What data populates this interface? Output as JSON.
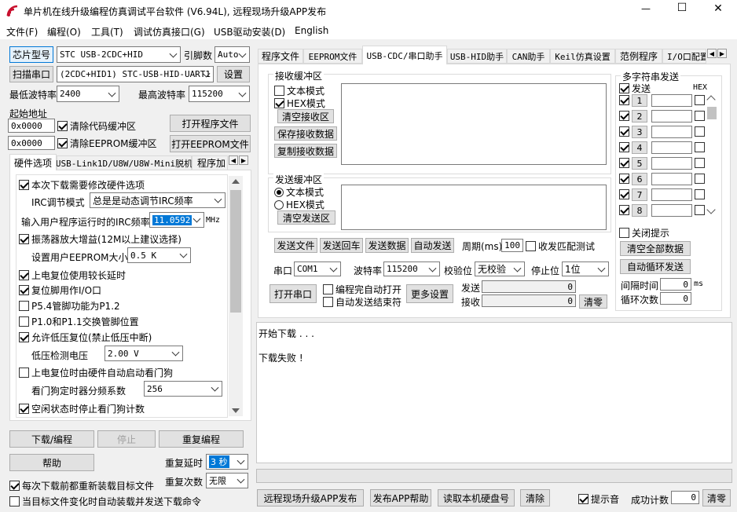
{
  "window": {
    "title": "单片机在线升级编程仿真调试平台软件 (V6.94L), 远程现场升级APP发布",
    "controls": {
      "minimize": "—",
      "maximize": "☐",
      "close": "✕"
    }
  },
  "menu": [
    "文件(F)",
    "编程(O)",
    "工具(T)",
    "调试仿真接口(G)",
    "USB驱动安装(D)",
    "English"
  ],
  "left": {
    "chip_btn": "芯片型号",
    "chip_value": "STC USB-2CDC+HID",
    "pin_label": "引脚数",
    "pin_value": "Auto",
    "scan_btn": "扫描串口",
    "port_value": "(2CDC+HID1) STC-USB-HID-UART1",
    "settings_btn": "设置",
    "min_baud_label": "最低波特率",
    "min_baud_value": "2400",
    "max_baud_label": "最高波特率",
    "max_baud_value": "115200",
    "start_addr_label": "起始地址",
    "addr1": "0x0000",
    "clear_code": "清除代码缓冲区",
    "open_prog": "打开程序文件",
    "addr2": "0x0000",
    "clear_eeprom": "清除EEPROM缓冲区",
    "open_eeprom": "打开EEPROM文件",
    "tabs": [
      "硬件选项",
      "USB-Link1D/U8W/U8W-Mini脱机",
      "程序加"
    ],
    "hw": {
      "modify_opts": "本次下载需要修改硬件选项",
      "irc_mode_label": "IRC调节模式",
      "irc_mode_value": "总是是动态调节IRC频率",
      "irc_freq_label": "输入用户程序运行时的IRC频率",
      "irc_freq_value": "11.0592",
      "mhz": "MHz",
      "osc_gain": "振荡器放大增益(12M以上建议选择)",
      "eeprom_size_label": "设置用户EEPROM大小",
      "eeprom_size_value": "0.5 K",
      "por_delay": "上电复位使用较长延时",
      "reset_io": "复位脚用作I/O口",
      "p54": "P5.4管脚功能为P1.2",
      "p10": "P1.0和P1.1交换管脚位置",
      "lvr": "允许低压复位(禁止低压中断)",
      "lvd_label": "低压检测电压",
      "lvd_value": "2.00 V",
      "wdt_auto": "上电复位时由硬件自动启动看门狗",
      "wdt_div_label": "看门狗定时器分频系数",
      "wdt_div_value": "256",
      "idle_wdt": "空闲状态时停止看门狗计数"
    },
    "download_btn": "下载/编程",
    "stop_btn": "停止",
    "reprogram_btn": "重复编程",
    "help_btn": "帮助",
    "repeat_delay_label": "重复延时",
    "repeat_delay_value": "3 秒",
    "repeat_count_label": "重复次数",
    "repeat_count_value": "无限",
    "reload_before": "每次下载前都重新装载目标文件",
    "auto_reload": "当目标文件变化时自动装载并发送下载命令"
  },
  "right": {
    "tabs": [
      "程序文件",
      "EEPROM文件",
      "USB-CDC/串口助手",
      "USB-HID助手",
      "CAN助手",
      "Keil仿真设置",
      "范例程序",
      "I/O口配置"
    ],
    "recv": {
      "title": "接收缓冲区",
      "text_mode": "文本模式",
      "hex_mode": "HEX模式",
      "clear": "清空接收区",
      "save": "保存接收数据",
      "copy": "复制接收数据"
    },
    "send": {
      "title": "发送缓冲区",
      "text_mode": "文本模式",
      "hex_mode": "HEX模式",
      "clear": "清空发送区"
    },
    "send_btns": [
      "发送文件",
      "发送回车",
      "发送数据",
      "自动发送"
    ],
    "period_label": "周期(ms)",
    "period_value": "100",
    "match_test": "收发匹配测试",
    "multi": {
      "title": "多字符串发送",
      "send_label": "发送",
      "hex_label": "HEX",
      "rows": [
        "1",
        "2",
        "3",
        "4",
        "5",
        "6",
        "7",
        "8"
      ],
      "close_hint": "关闭提示",
      "clear_all": "清空全部数据",
      "auto_loop": "自动循环发送",
      "interval_label": "间隔时间",
      "interval_value": "0",
      "ms": "ms",
      "loop_label": "循环次数",
      "loop_value": "0"
    },
    "serial": {
      "port_label": "串口",
      "port_value": "COM1",
      "baud_label": "波特率",
      "baud_value": "115200",
      "parity_label": "校验位",
      "parity_value": "无校验",
      "stop_label": "停止位",
      "stop_value": "1位",
      "open_btn": "打开串口",
      "auto_open": "编程完自动打开",
      "auto_send_end": "自动发送结束符",
      "more_btn": "更多设置",
      "tx_label": "发送",
      "tx_value": "0",
      "rx_label": "接收",
      "rx_value": "0",
      "clear_btn": "清零"
    },
    "log": [
      "开始下载 . . .",
      "",
      "下载失败 !"
    ],
    "bottom": {
      "publish": "远程现场升级APP发布",
      "publish_help": "发布APP帮助",
      "read_disk": "读取本机硬盘号",
      "clear": "清除",
      "beep": "提示音",
      "success_label": "成功计数",
      "success_value": "0",
      "reset": "清零"
    }
  }
}
